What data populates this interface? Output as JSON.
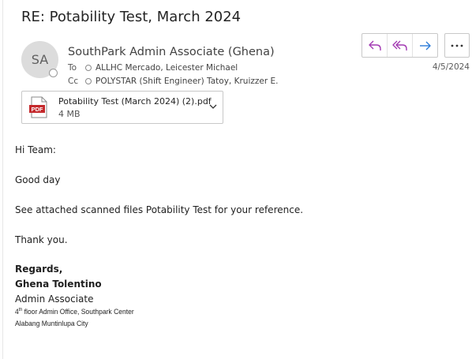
{
  "email": {
    "subject": "RE: Potability Test, March 2024",
    "avatar_initials": "SA",
    "sender": "SouthPark Admin Associate (Ghena)",
    "to_label": "To",
    "to_value": "ALLHC Mercado, Leicester Michael",
    "cc_label": "Cc",
    "cc_value": "POLYSTAR (Shift Engineer) Tatoy, Kruizzer E.",
    "date": "4/5/2024",
    "actions": {
      "reply_icon": "reply-icon",
      "reply_all_icon": "reply-all-icon",
      "forward_icon": "forward-icon",
      "more_icon": "more-options-icon"
    },
    "attachment": {
      "name": "Potability Test (March 2024) (2).pdf",
      "size": "4 MB",
      "badge": "PDF"
    }
  },
  "body": {
    "greeting": "Hi Team:",
    "line1": "Good day",
    "line2": "See attached scanned files Potability Test for your reference.",
    "thanks": "Thank you.",
    "regards": "Regards,",
    "sig_name": "Ghena Tolentino",
    "sig_title": "Admin Associate",
    "sig_addr1_sup": "th",
    "sig_addr1_pre": "4",
    "sig_addr1": " floor Admin Office, Southpark Center",
    "sig_addr2": "Alabang Muntinlupa City"
  },
  "colors": {
    "reply_accent": "#a33ab3",
    "forward_accent": "#2b7bd8",
    "pdf_red": "#c4282b"
  }
}
